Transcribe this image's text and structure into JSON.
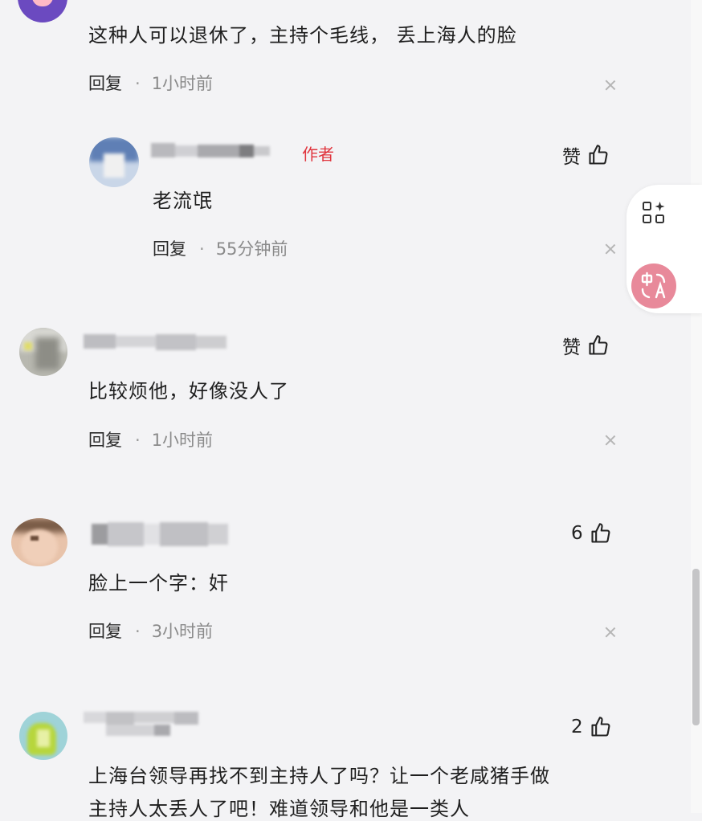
{
  "comments": [
    {
      "text": "这种人可以退休了，主持个毛线， 丢上海人的脸",
      "reply_label": "回复",
      "time": "1小时前"
    },
    {
      "is_author": true,
      "author_tag": "作者",
      "like_label": "赞",
      "text": "老流氓",
      "reply_label": "回复",
      "time": "55分钟前"
    },
    {
      "like_label": "赞",
      "text": "比较烦他，好像没人了",
      "reply_label": "回复",
      "time": "1小时前"
    },
    {
      "like_label": "6",
      "text": "脸上一个字：奸",
      "reply_label": "回复",
      "time": "3小时前"
    },
    {
      "like_label": "2",
      "text_line1": "上海台领导再找不到主持人了吗？让一个老咸猪手做",
      "text_line2": "主持人太丢人了吧！难道领导和他是一类人"
    }
  ],
  "side_buttons": [
    "grid-sparkle-icon",
    "translate-icon"
  ],
  "colors": {
    "background": "#f3f3f5",
    "author_tag": "#e0333c",
    "translate_button": "#e8899a"
  }
}
